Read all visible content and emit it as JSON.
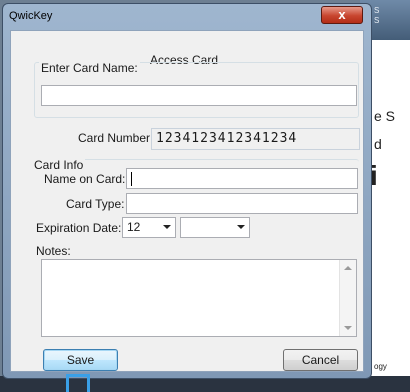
{
  "window": {
    "title": "QwicKey",
    "close_glyph": "x"
  },
  "dialog": {
    "heading": "Access Card"
  },
  "card_name": {
    "label": "Enter Card Name:",
    "value": ""
  },
  "card_number": {
    "label": "Card Number:",
    "value": "1234123412341234"
  },
  "card_info": {
    "legend": "Card Info",
    "name_on_card_label": "Name on Card:",
    "name_on_card_value": "",
    "card_type_label": "Card Type:",
    "card_type_value": "",
    "expiration_label": "Expiration Date:",
    "expiration_month": "12",
    "expiration_year": ""
  },
  "notes": {
    "label": "Notes:",
    "value": ""
  },
  "buttons": {
    "save": "Save",
    "cancel": "Cancel"
  },
  "background": {
    "text1": "e S",
    "text2": "d",
    "text3": "i",
    "text4": "ogy"
  }
}
